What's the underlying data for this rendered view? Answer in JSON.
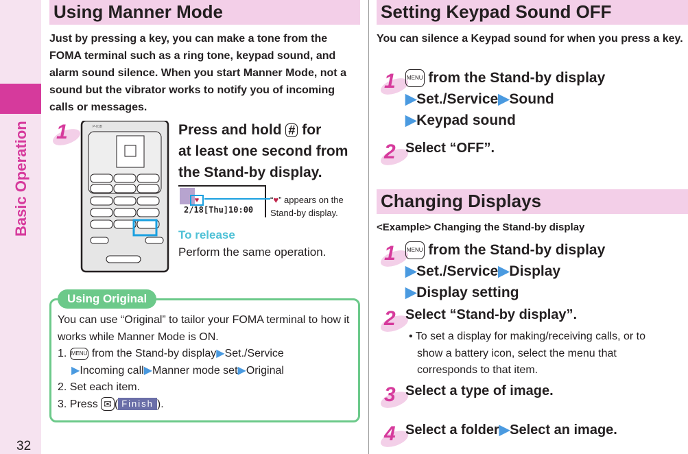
{
  "sidebar": {
    "section": "Basic Operation",
    "page_number": "32"
  },
  "left": {
    "header": "Using Manner Mode",
    "intro": "Just by pressing a key, you can make a tone from the FOMA terminal such as a ring tone, keypad sound, and alarm sound silence. When you start Manner Mode, not a sound but the vibrator works to notify you of incoming calls or messages.",
    "step1": {
      "num": "1",
      "line1": "Press and hold",
      "key": "#",
      "line1b": "for",
      "line2": "at least one second from",
      "line3": "the Stand-by display."
    },
    "screen": {
      "datetime": "2/18[Thu]10:00",
      "caption_pre": "“",
      "caption_post": "” appears on the",
      "caption2": "Stand-by display."
    },
    "release": {
      "title": "To release",
      "text": "Perform the same operation."
    },
    "phone": {
      "model": "P-01B"
    },
    "tip": {
      "label": "Using Original",
      "text": "You can use “Original” to tailor your FOMA terminal to how it works while Manner Mode is ON.",
      "item1_num": "1.",
      "menu_key": "MENU",
      "item1_a": "from the Stand-by display",
      "item1_b": "Set./Service",
      "item1_c": "Incoming call",
      "item1_d": "Manner mode set",
      "item1_e": "Original",
      "item2": "2. Set each item.",
      "item3_a": "3. Press",
      "item3_paren_open": "(",
      "finish": "Finish",
      "item3_paren_close": ")."
    }
  },
  "right": {
    "section1": {
      "header": "Setting Keypad Sound OFF",
      "intro": "You can silence a Keypad sound for when you press a key.",
      "steps": [
        {
          "num": "1",
          "menu_key": "MENU",
          "a": "from the Stand-by display",
          "b": "Set./Service",
          "c": "Sound",
          "d": "Keypad sound"
        },
        {
          "num": "2",
          "text": "Select “OFF”."
        }
      ]
    },
    "section2": {
      "header": "Changing Displays",
      "example": "<Example> Changing the Stand-by display",
      "steps": [
        {
          "num": "1",
          "menu_key": "MENU",
          "a": "from the Stand-by display",
          "b": "Set./Service",
          "c": "Display",
          "d": "Display setting"
        },
        {
          "num": "2",
          "text": "Select “Stand-by display”.",
          "note": "• To set a display for making/receiving calls, or to show a battery icon, select the menu that corresponds to that item."
        },
        {
          "num": "3",
          "text": "Select a type of image."
        },
        {
          "num": "4",
          "a": "Select a folder",
          "b": "Select an image."
        }
      ]
    }
  },
  "colors": {
    "accent": "#d63a9c",
    "header_bg": "#f3cfe8",
    "arrow": "#4a9ae0",
    "tip_green": "#6cc98a",
    "release": "#4fc1d6"
  }
}
